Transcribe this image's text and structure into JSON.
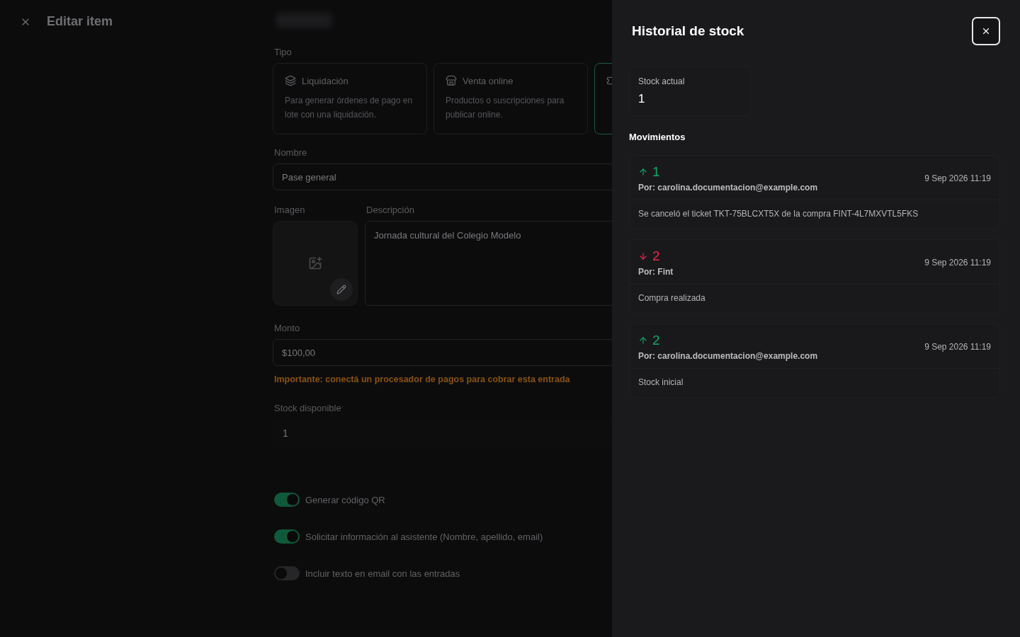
{
  "editor": {
    "title": "Editar item",
    "type_label": "Tipo",
    "types": [
      {
        "kind": "layers",
        "title": "Liquidación",
        "description": "Para generar órdenes de pago en lote con una liquidación.",
        "selected": false
      },
      {
        "kind": "store",
        "title": "Venta online",
        "description": "Productos o suscripciones para publicar online.",
        "selected": false
      },
      {
        "kind": "ticket",
        "selected": true
      }
    ],
    "name_label": "Nombre",
    "name_value": "Pase general",
    "image_label": "Imagen",
    "description_label": "Descripción",
    "description_value": "Jornada cultural del Colegio Modelo",
    "amount_label": "Monto",
    "amount_value": "$100,00",
    "warning": "Importante: conectá un procesador de pagos para cobrar esta entrada",
    "stock_label": "Stock disponible",
    "stock_value": "1",
    "toggles": [
      {
        "label": "Generar código QR",
        "on": true
      },
      {
        "label": "Solicitar información al asistente (Nombre, apellido, email)",
        "on": true
      },
      {
        "label": "Incluir texto en email con las entradas",
        "on": false
      }
    ]
  },
  "panel": {
    "title": "Historial de stock",
    "current_label": "Stock actual",
    "current_value": "1",
    "movements_label": "Movimientos",
    "movements": [
      {
        "kind": "in",
        "amount": "1",
        "by": "Por: carolina.documentacion@example.com",
        "date": "9 Sep 2026 11:19",
        "note": "Se canceló el ticket TKT-75BLCXT5X de la compra FINT-4L7MXVTL5FKS"
      },
      {
        "kind": "out",
        "amount": "2",
        "by": "Por: Fint",
        "date": "9 Sep 2026 11:19",
        "note": "Compra realizada"
      },
      {
        "kind": "in",
        "amount": "2",
        "by": "Por: carolina.documentacion@example.com",
        "date": "9 Sep 2026 11:19",
        "note": "Stock inicial"
      }
    ]
  }
}
